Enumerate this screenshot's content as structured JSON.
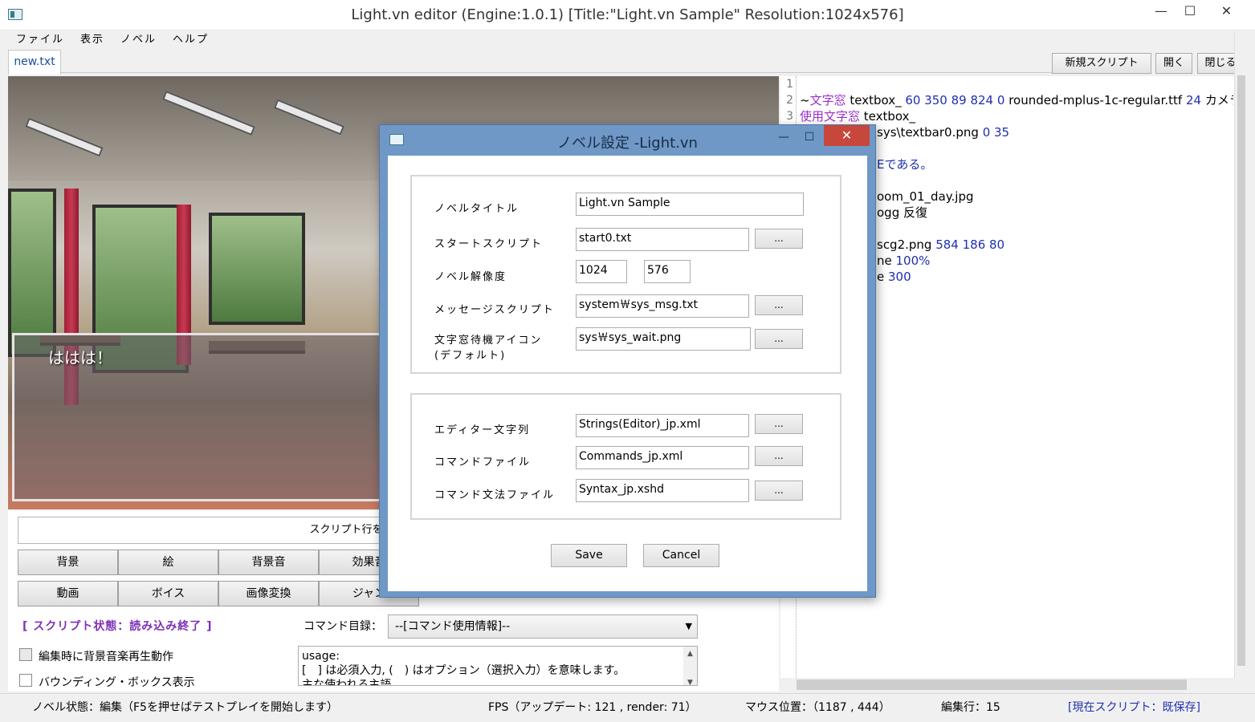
{
  "window": {
    "title": "Light.vn editor (Engine:1.0.1) [Title:\"Light.vn Sample\" Resolution:1024x576]",
    "minimize": "—",
    "maximize": "☐",
    "close": "✕"
  },
  "menu": [
    "ファイル",
    "表示",
    "ノベル",
    "ヘルプ"
  ],
  "tabs": {
    "active": "new.txt",
    "new_script": "新規スクリプト",
    "open": "開く",
    "close": "閉じる"
  },
  "stage": {
    "message": "ははは！"
  },
  "code": {
    "line_numbers": [
      "1",
      "2",
      "3"
    ],
    "lines": [
      {
        "segments": []
      },
      {
        "segments": [
          {
            "t": "~",
            "c": ""
          },
          {
            "t": "文字窓",
            "c": "kw"
          },
          {
            "t": " textbox_ ",
            "c": ""
          },
          {
            "t": "60 350 89 824 0",
            "c": "num"
          },
          {
            "t": " rounded-mplus-1c-regular.ttf ",
            "c": ""
          },
          {
            "t": "24",
            "c": "num"
          },
          {
            "t": " カメラ",
            "c": ""
          }
        ]
      },
      {
        "segments": [
          {
            "t": "使用文字窓",
            "c": "kw"
          },
          {
            "t": " textbox_",
            "c": ""
          }
        ]
      },
      {
        "segments": [
          {
            "t": "sys\\textbar0.png ",
            "c": ""
          },
          {
            "t": "0 35",
            "c": "num"
          }
        ]
      },
      {
        "segments": []
      },
      {
        "segments": [
          {
            "t": "Eである。",
            "c": "num"
          }
        ]
      },
      {
        "segments": []
      },
      {
        "segments": [
          {
            "t": "oom_01_day.jpg",
            "c": ""
          }
        ]
      },
      {
        "segments": [
          {
            "t": "ogg 反復",
            "c": ""
          }
        ]
      },
      {
        "segments": []
      },
      {
        "segments": [
          {
            "t": "scg2.png ",
            "c": ""
          },
          {
            "t": "584 186 80",
            "c": "num"
          }
        ]
      },
      {
        "segments": [
          {
            "t": "ne ",
            "c": ""
          },
          {
            "t": "100%",
            "c": "num"
          }
        ]
      },
      {
        "segments": [
          {
            "t": "e ",
            "c": ""
          },
          {
            "t": "300",
            "c": "num"
          }
        ]
      }
    ]
  },
  "panel": {
    "hint": "スクリプト行をクリック",
    "row1": [
      "背景",
      "絵",
      "背景音",
      "効果音"
    ],
    "row2": [
      "動画",
      "ボイス",
      "画像変換",
      "ジャン"
    ],
    "script_status": "[ スクリプト状態：読み込み終了 ]",
    "command_list_label": "コマンド目録：",
    "command_select": "--[コマンド使用情報]--",
    "check_bgm": "編集時に背景音楽再生動作",
    "check_bbox": "バウンディング・ボックス表示",
    "usage_line1": "usage:",
    "usage_line2": "[　] は必須入力, (　) はオプション（選択入力）を意味します。",
    "usage_line3": "主な使われる主語"
  },
  "statusbar": {
    "novel_state": "ノベル状態：編集（F5を押せばテストプレイを開始します）",
    "fps": "FPS（アップデート: 121 , render: 71）",
    "mouse": "マウス位置：（1187 , 444）",
    "edit_line": "編集行：15",
    "current_script": "[現在スクリプト：既保存]"
  },
  "dialog": {
    "title": "ノベル設定 -Light.vn",
    "labels": {
      "novel_title": "ノベルタイトル",
      "start_script": "スタートスクリプト",
      "resolution": "ノベル解像度",
      "message_script": "メッセージスクリプト",
      "wait_icon_1": "文字窓待機アイコン",
      "wait_icon_2": "(デフォルト)",
      "editor_strings": "エディター文字列",
      "command_file": "コマンドファイル",
      "syntax_file": "コマンド文法ファイル"
    },
    "values": {
      "novel_title": "Light.vn Sample",
      "start_script": "start0.txt",
      "width": "1024",
      "height": "576",
      "message_script": "system￦sys_msg.txt",
      "wait_icon": "sys￦sys_wait.png",
      "editor_strings": "Strings(Editor)_jp.xml",
      "command_file": "Commands_jp.xml",
      "syntax_file": "Syntax_jp.xshd"
    },
    "browse": "...",
    "save": "Save",
    "cancel": "Cancel"
  },
  "colors": {
    "dialog_frame": "#6f98c7",
    "close_red": "#c7473c",
    "keyword": "#9b2fc8",
    "number": "#1f2fb0",
    "status_purple": "#7e2fb8"
  }
}
